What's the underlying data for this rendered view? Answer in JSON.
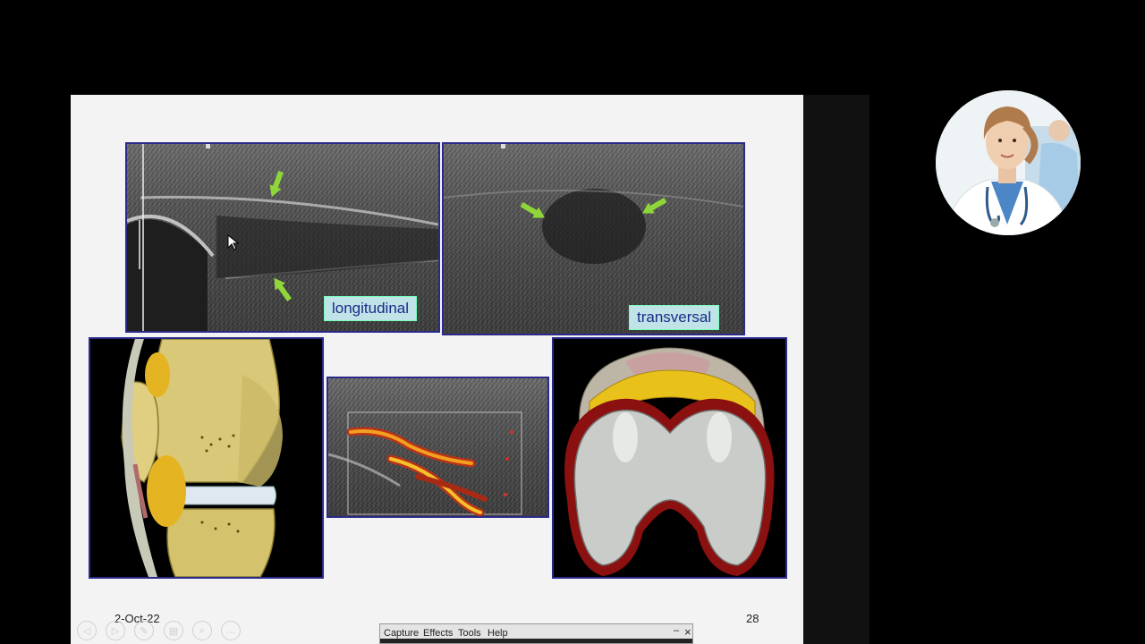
{
  "slide": {
    "date": "2-Oct-22",
    "page_number": "28",
    "label_longitudinal": "longitudinal",
    "label_transversal": "transversal"
  },
  "nav_controls": [
    {
      "icon": "prev-icon",
      "glyph": "◁"
    },
    {
      "icon": "next-icon",
      "glyph": "▷"
    },
    {
      "icon": "pen-icon",
      "glyph": "✎"
    },
    {
      "icon": "slides-icon",
      "glyph": "▤"
    },
    {
      "icon": "zoom-icon",
      "glyph": "⌕"
    },
    {
      "icon": "more-icon",
      "glyph": "…"
    }
  ],
  "capture_menu": {
    "items": [
      "Capture",
      "Effects",
      "Tools",
      "Help"
    ],
    "minimize_glyph": "–",
    "close_glyph": "×"
  },
  "colors": {
    "slide_bg": "#f2f3f2",
    "frame_border": "#2a2a8a",
    "arrow_green": "#8fd63a",
    "label_bg": "#bfe3e6",
    "label_text": "#1a2b8a"
  },
  "icons": {
    "avatar": "doctor-avatar",
    "cursor": "mouse-cursor-icon"
  }
}
